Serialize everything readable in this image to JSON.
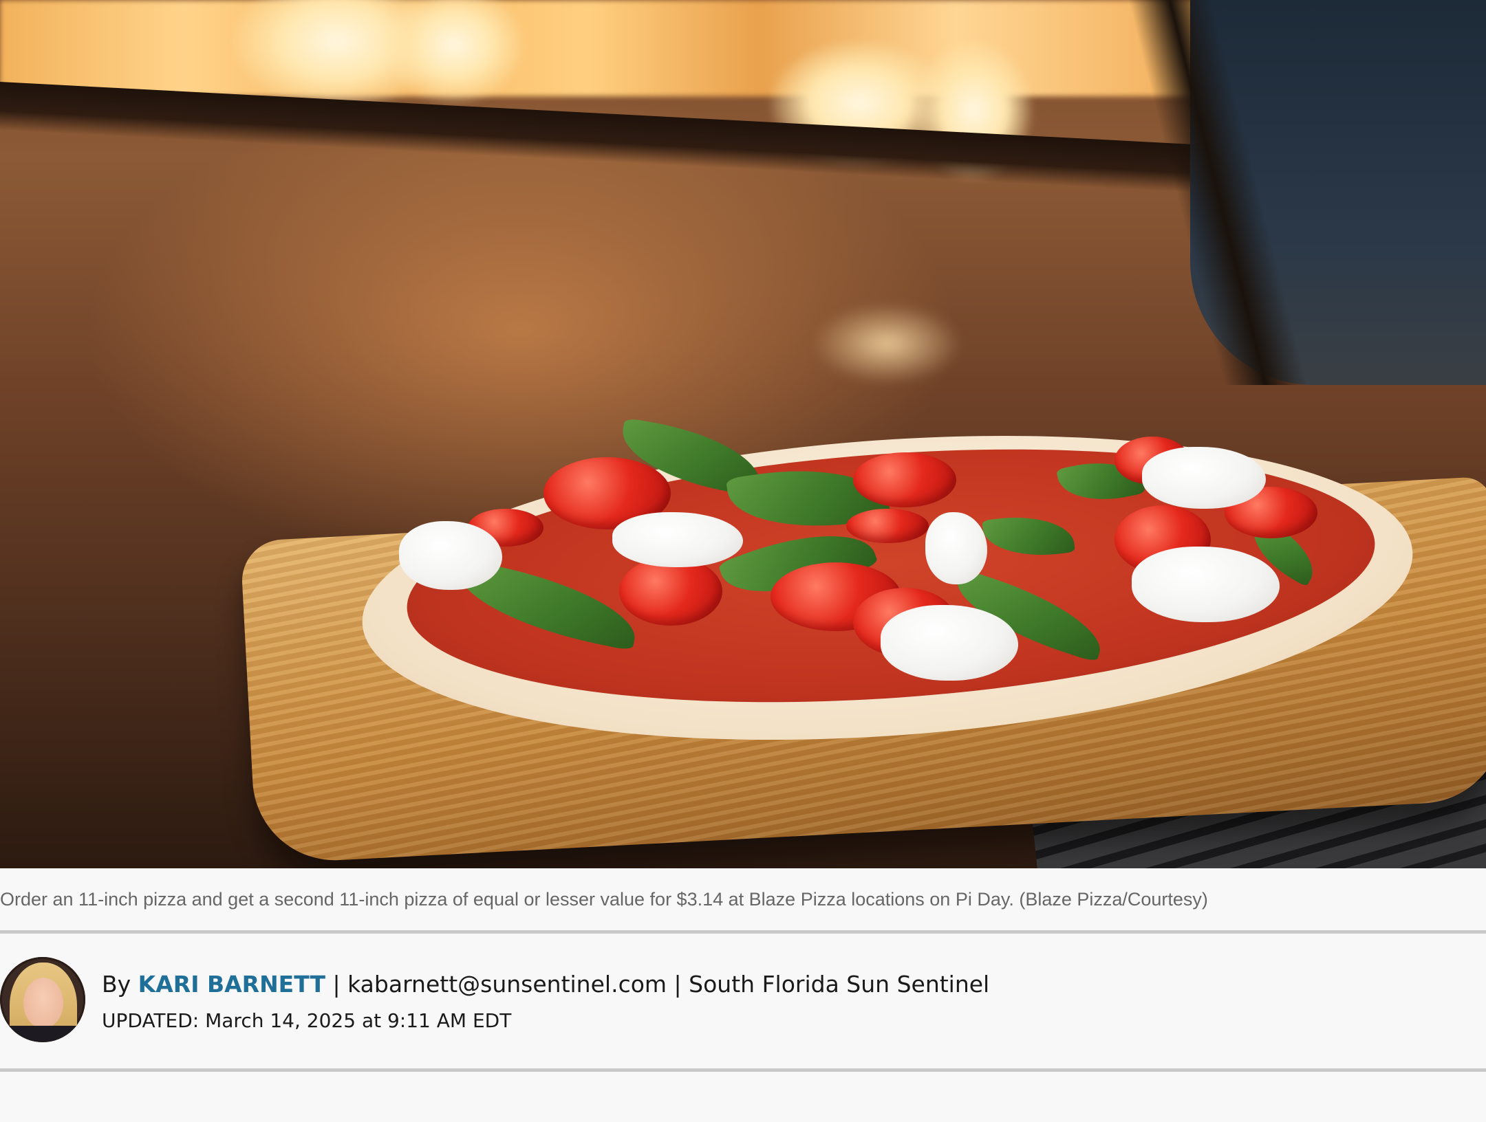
{
  "photo": {
    "subject": "pizza-on-wooden-peel-in-oven"
  },
  "caption": {
    "text": "Order an 11-inch pizza and get a second 11-inch pizza of equal or lesser value for $3.14 at Blaze Pizza locations on Pi Day. (Blaze Pizza/Courtesy)"
  },
  "byline": {
    "prefix": "By",
    "author": "KARI BARNETT",
    "separator": "|",
    "email": "kabarnett@sunsentinel.com",
    "publication": "South Florida Sun Sentinel",
    "updated": "UPDATED: March 14, 2025 at 9:11 AM EDT"
  },
  "colors": {
    "author_link": "#1f6f99",
    "rule": "#c9c9c9",
    "caption_text": "#666666"
  }
}
